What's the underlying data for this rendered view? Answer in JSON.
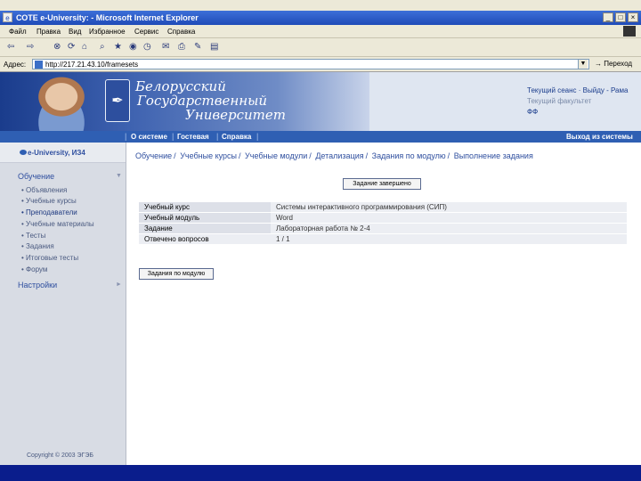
{
  "window": {
    "title": "СОТЕ e-University: - Microsoft Internet Explorer",
    "btn_min": "_",
    "btn_max": "□",
    "btn_close": "×"
  },
  "menu": [
    "Файл",
    "Правка",
    "Вид",
    "Избранное",
    "Сервис",
    "Справка"
  ],
  "address": {
    "label": "Адрес:",
    "url": "http://217.21.43.10/framesets",
    "go": "Переход"
  },
  "banner": {
    "uni_line1": "Белорусский",
    "uni_line2": "Государственный",
    "uni_line3": "Университет",
    "session": "Текущий сеанс",
    "logout": "Выйду - Рама",
    "faculty": "Текущий факультет",
    "faculty_value": "ФФ"
  },
  "nav": {
    "about": "О системе",
    "guestbook": "Гостевая",
    "help": "Справка",
    "exit": "Выход из системы"
  },
  "sidebar": {
    "brand": "e-University, ИЗ4",
    "section_learning": "Обучение",
    "items": [
      "Объявления",
      "Учебные курсы",
      "Преподаватели",
      "Учебные материалы",
      "Тесты",
      "Задания",
      "Итоговые тесты",
      "Форум"
    ],
    "section_settings": "Настройки",
    "copyright": "Copyright © 2003 ЭГЭБ"
  },
  "main": {
    "breadcrumb": [
      "Обучение",
      "Учебные курсы",
      "Учебные модули",
      "Детализация",
      "Задания по модулю",
      "Выполнение задания"
    ],
    "done_button": "Задание завершено",
    "rows": [
      {
        "key": "Учебный курс",
        "value": "Системы интерактивного программирования (СИП)"
      },
      {
        "key": "Учебный модуль",
        "value": "Word"
      },
      {
        "key": "Задание",
        "value": "Лабораторная работа № 2-4"
      },
      {
        "key": "Отвечено вопросов",
        "value": "1 / 1"
      }
    ],
    "back_button": "Задания по модулю"
  }
}
